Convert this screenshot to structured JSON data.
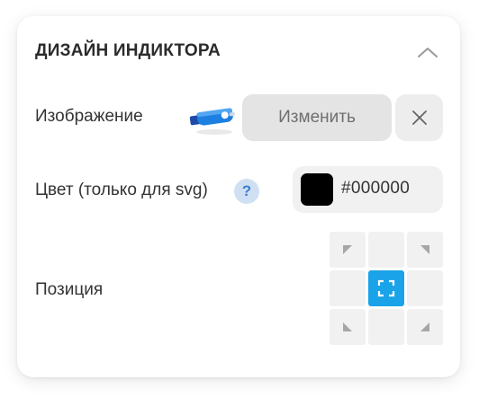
{
  "panel": {
    "title": "ДИЗАЙН ИНДИКТОРА"
  },
  "image_row": {
    "label": "Изображение",
    "change_label": "Изменить"
  },
  "color_row": {
    "label": "Цвет (только для svg)",
    "help": "?",
    "value": "#000000",
    "swatch_color": "#000000"
  },
  "position_row": {
    "label": "Позиция",
    "selected": "center",
    "cells": [
      "top-left",
      "top",
      "top-right",
      "left",
      "center",
      "right",
      "bottom-left",
      "bottom",
      "bottom-right"
    ]
  },
  "colors": {
    "accent": "#1aa3e8",
    "text": "#333333",
    "button_bg": "#e4e4e4",
    "help_bg": "#cfe0f3",
    "help_fg": "#3c7fd0"
  },
  "icons": {
    "collapse": "chevron-up-icon",
    "remove": "close-icon",
    "help": "question-icon",
    "thumbnail": "pen-drive-image",
    "selected_cell": "expand-frame-icon"
  }
}
